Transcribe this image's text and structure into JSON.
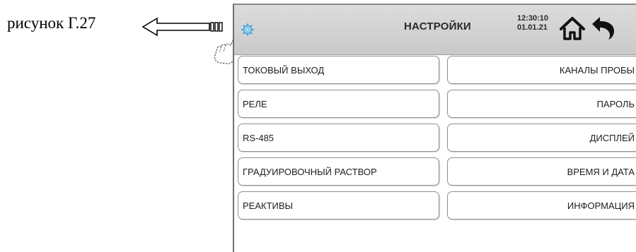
{
  "caption": "рисунок Г.27",
  "header": {
    "title": "НАСТРОЙКИ",
    "time": "12:30:10",
    "date": "01.01.21"
  },
  "icons": [
    "gear-icon",
    "home-icon",
    "back-arrow-icon",
    "pointing-hand-icon",
    "left-arrow-icon"
  ],
  "menu": {
    "left": [
      "ТОКОВЫЙ ВЫХОД",
      "РЕЛЕ",
      "RS-485",
      "ГРАДУИРОВОЧНЫЙ РАСТВОР",
      "РЕАКТИВЫ"
    ],
    "right": [
      "КАНАЛЫ ПРОБЫ",
      "ПАРОЛЬ",
      "ДИСПЛЕЙ",
      "ВРЕМЯ И ДАТА",
      "ИНФОРМАЦИЯ"
    ]
  },
  "colors": {
    "header_bg": "#d2d2d2",
    "border": "#8f8f8f",
    "gear": "#5ab4e6"
  }
}
